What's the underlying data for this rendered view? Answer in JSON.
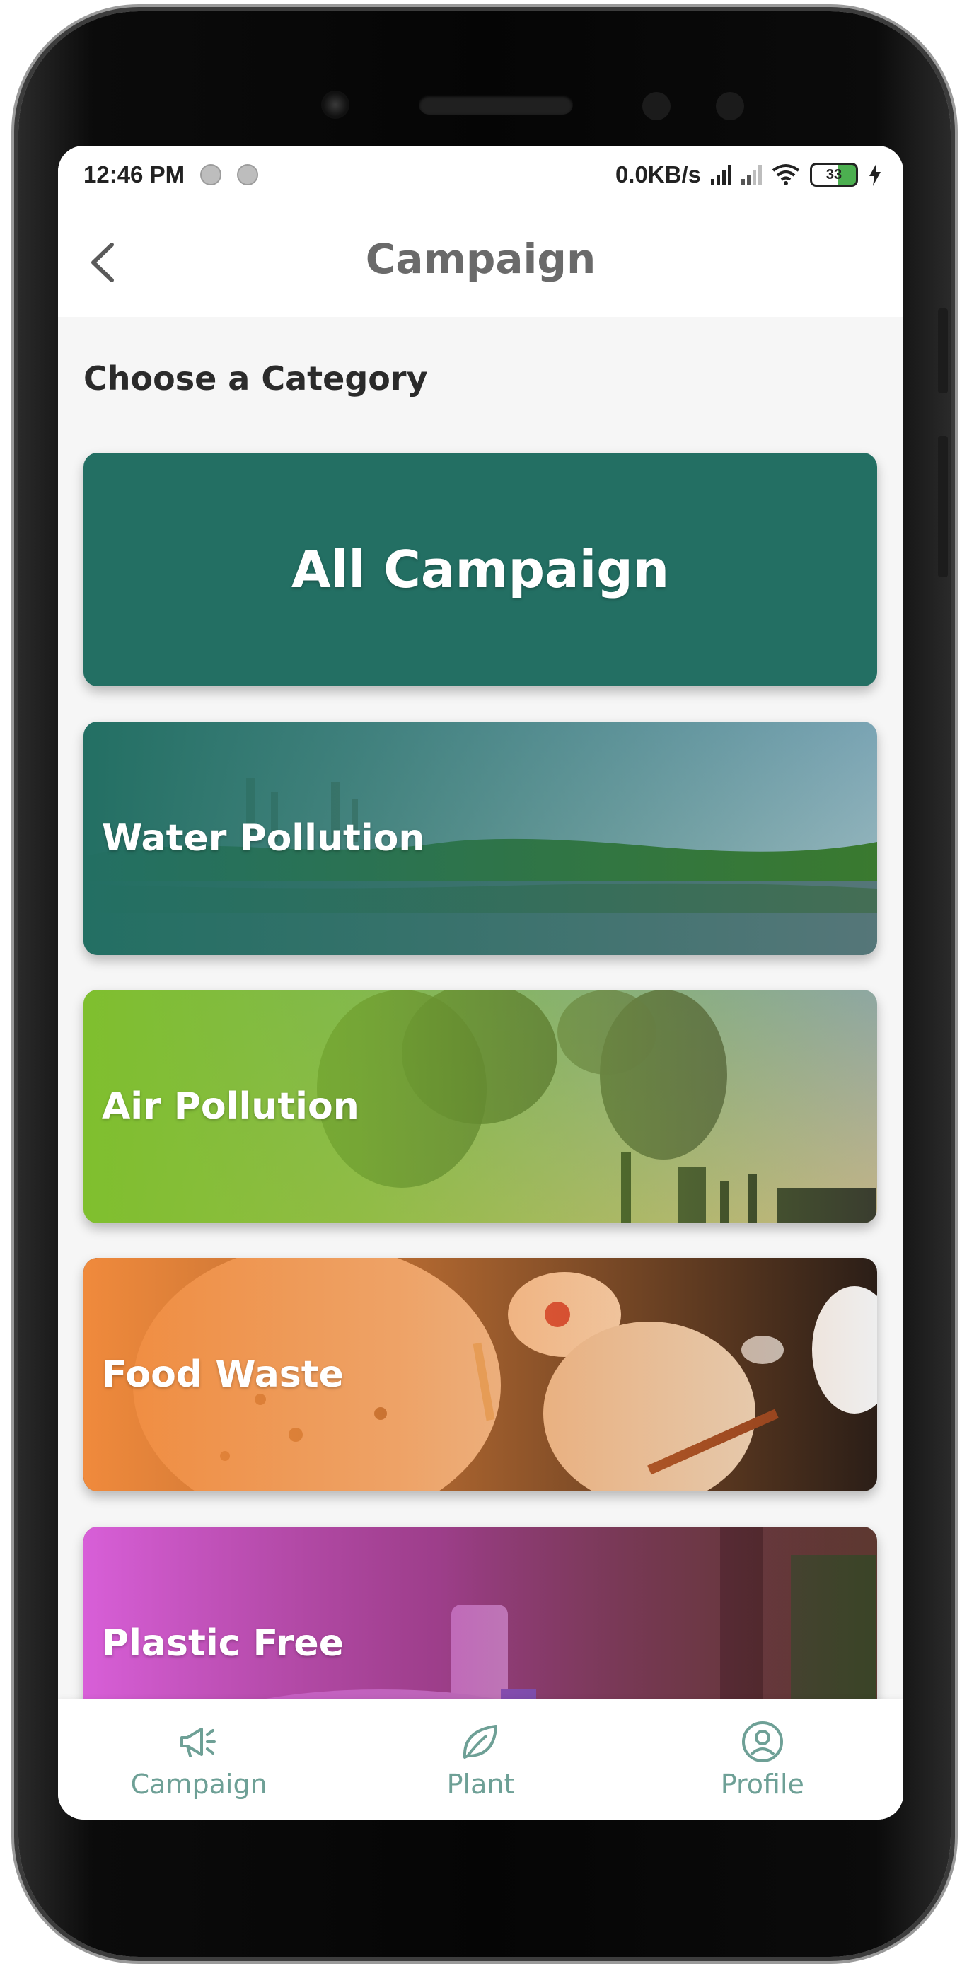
{
  "status_bar": {
    "time": "12:46 PM",
    "network_speed": "0.0KB/s",
    "battery": "33"
  },
  "header": {
    "title": "Campaign",
    "back_icon": "chevron-left-icon"
  },
  "section": {
    "title": "Choose a Category"
  },
  "categories": [
    {
      "label": "All Campaign",
      "color": "#236f63"
    },
    {
      "label": "Water Pollution",
      "color": "#236f63"
    },
    {
      "label": "Air Pollution",
      "color": "#7fbf2e"
    },
    {
      "label": "Food Waste",
      "color": "#f08a3c"
    },
    {
      "label": "Plastic Free",
      "color": "#d85fd8"
    }
  ],
  "bottom_nav": [
    {
      "label": "Campaign",
      "icon": "megaphone-icon"
    },
    {
      "label": "Plant",
      "icon": "leaf-icon"
    },
    {
      "label": "Profile",
      "icon": "user-circle-icon"
    }
  ],
  "colors": {
    "brand": "#236f63",
    "nav_icon": "#6ea096",
    "background": "#f6f6f6"
  }
}
